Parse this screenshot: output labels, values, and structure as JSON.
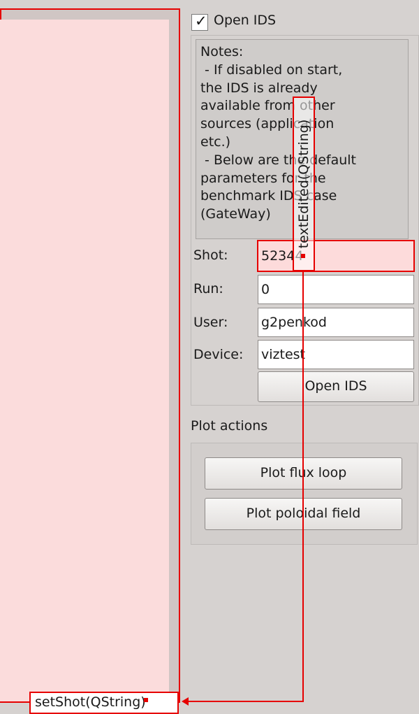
{
  "checkbox": {
    "label": "Open IDS",
    "checked": true
  },
  "notes": {
    "lines": [
      "Notes:",
      " - If disabled on start,",
      "the IDS is already",
      "available from other",
      "sources (application",
      "etc.)",
      " - Below are the default",
      "parameters for the",
      "benchmark IDS case",
      "(GateWay)"
    ]
  },
  "form": {
    "shot_label": "Shot:",
    "shot_value": "52344",
    "run_label": "Run:",
    "run_value": "0",
    "user_label": "User:",
    "user_value": "g2penkod",
    "device_label": "Device:",
    "device_value": "viztest",
    "open_ids_button": "Open IDS"
  },
  "plot_actions": {
    "title": "Plot actions",
    "flux_loop_button": "Plot flux loop",
    "poloidal_field_button": "Plot poloidal field"
  },
  "connection": {
    "signal": "textEdited(QString)",
    "slot": "setShot(QString)",
    "color": "#e60000"
  }
}
